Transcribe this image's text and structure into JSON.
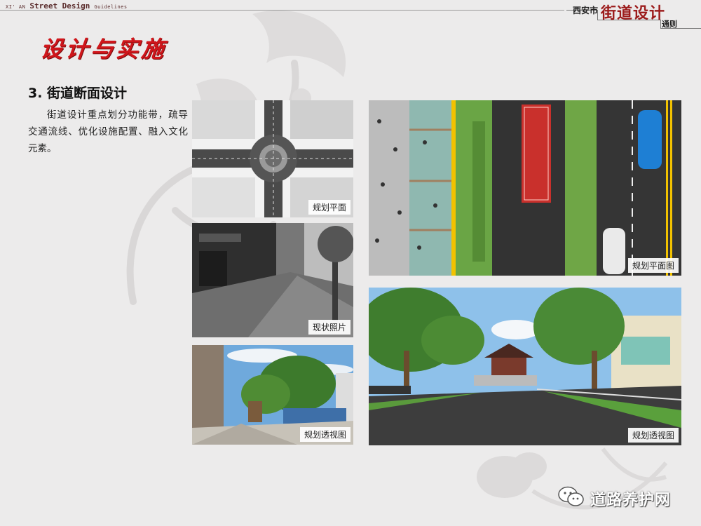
{
  "header": {
    "left_prefix": "XI' AN",
    "left_title": "Street Design",
    "left_suffix": "Guidelines",
    "logo_city": "西安市",
    "logo_main": "街道设计",
    "logo_sub": "通则"
  },
  "page_title": "设计与实施",
  "section": {
    "heading": "3. 街道断面设计",
    "body": "街道设计重点划分功能带，疏导交通流线、优化设施配置、融入文化元素。"
  },
  "images": {
    "plan": {
      "caption": "规划平面"
    },
    "photo": {
      "caption": "现状照片"
    },
    "persp1": {
      "caption": "规划透视图"
    },
    "plan2": {
      "caption": "规划平面图"
    },
    "persp2": {
      "caption": "规划透视图"
    }
  },
  "watermark": {
    "text": "道路养护网"
  },
  "colors": {
    "title_red": "#d0161b",
    "logo_red": "#9c1c1c",
    "background": "#ecebeb"
  }
}
